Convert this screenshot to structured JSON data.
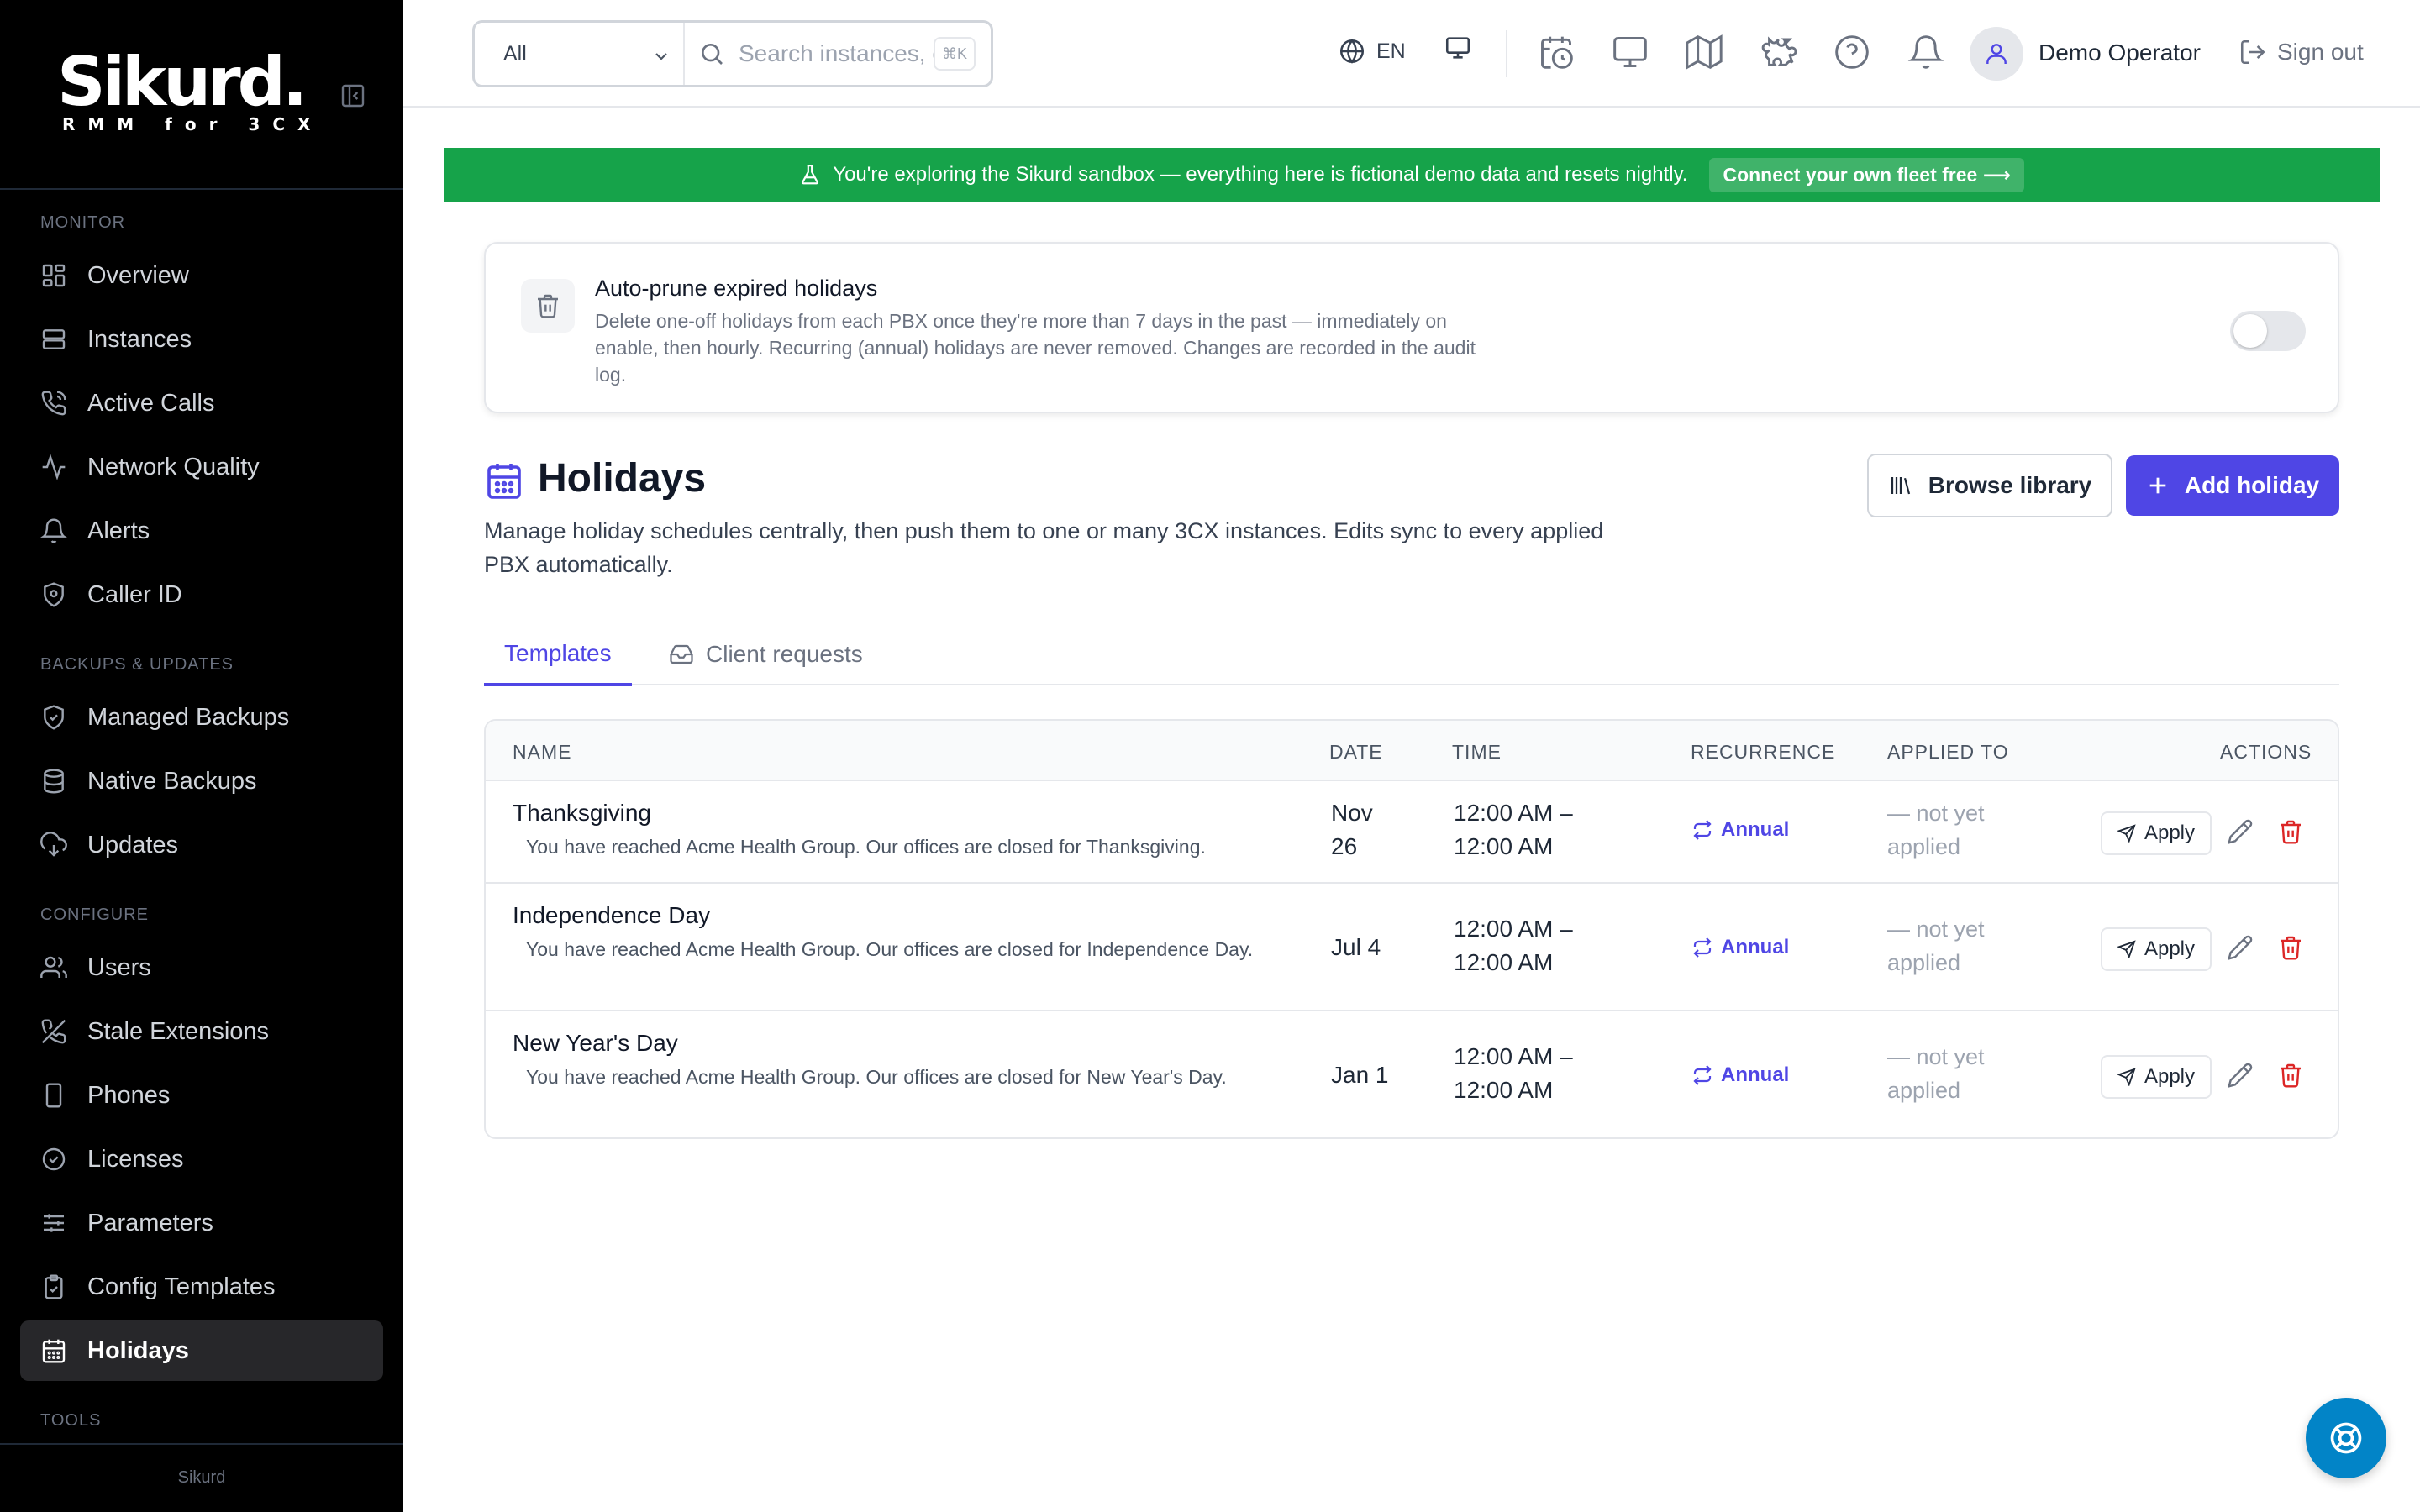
{
  "app": {
    "brand_name": "Sikurd.",
    "brand_tagline": "RMM for 3CX",
    "footer": "Sikurd"
  },
  "sidebar": {
    "sections": [
      {
        "title": "MONITOR",
        "items": [
          {
            "label": "Overview",
            "icon": "overview-icon"
          },
          {
            "label": "Instances",
            "icon": "server-icon"
          },
          {
            "label": "Active Calls",
            "icon": "phone-call-icon"
          },
          {
            "label": "Network Quality",
            "icon": "activity-icon"
          },
          {
            "label": "Alerts",
            "icon": "bell-icon"
          },
          {
            "label": "Caller ID",
            "icon": "shield-icon"
          }
        ]
      },
      {
        "title": "BACKUPS & UPDATES",
        "items": [
          {
            "label": "Managed Backups",
            "icon": "shield-check-icon"
          },
          {
            "label": "Native Backups",
            "icon": "database-icon"
          },
          {
            "label": "Updates",
            "icon": "cloud-download-icon"
          }
        ]
      },
      {
        "title": "CONFIGURE",
        "items": [
          {
            "label": "Users",
            "icon": "users-icon"
          },
          {
            "label": "Stale Extensions",
            "icon": "phone-off-icon"
          },
          {
            "label": "Phones",
            "icon": "smartphone-icon"
          },
          {
            "label": "Licenses",
            "icon": "badge-check-icon"
          },
          {
            "label": "Parameters",
            "icon": "sliders-icon"
          },
          {
            "label": "Config Templates",
            "icon": "clipboard-icon"
          },
          {
            "label": "Holidays",
            "icon": "calendar-icon",
            "active": true
          }
        ]
      },
      {
        "title": "TOOLS",
        "items": []
      }
    ]
  },
  "header": {
    "scope_value": "All",
    "search_placeholder": "Search instances, extensions, phones…",
    "shortcut": "⌘K",
    "language": "EN",
    "user_name": "Demo Operator",
    "sign_out": "Sign out"
  },
  "banner": {
    "text": "You're exploring the Sikurd sandbox — everything here is fictional demo data and resets nightly.",
    "cta": "Connect your own fleet free ⟶",
    "color": "#16a34a"
  },
  "auto_prune": {
    "title": "Auto-prune expired holidays",
    "description": "Delete one-off holidays from each PBX once they're more than 7 days in the past — immediately on enable, then hourly. Recurring (annual) holidays are never removed. Changes are recorded in the audit log.",
    "enabled": false
  },
  "page": {
    "title": "Holidays",
    "description": "Manage holiday schedules centrally, then push them to one or many 3CX instances. Edits sync to every applied PBX automatically.",
    "browse_library": "Browse library",
    "add_holiday": "Add holiday",
    "accent": "#4f46e5"
  },
  "tabs": [
    {
      "label": "Templates",
      "active": true
    },
    {
      "label": "Client requests",
      "active": false
    }
  ],
  "table": {
    "columns": {
      "name": "NAME",
      "date": "DATE",
      "time": "TIME",
      "recurrence": "RECURRENCE",
      "applied_to": "APPLIED TO",
      "actions": "ACTIONS"
    },
    "apply_label": "Apply",
    "rows": [
      {
        "name": "Thanksgiving",
        "message": "You have reached Acme Health Group. Our offices are closed for Thanksgiving.",
        "date_line1": "Nov",
        "date_line2": "26",
        "time_line1": "12:00 AM –",
        "time_line2": "12:00 AM",
        "recurrence": "Annual",
        "applied_line1": "— not yet",
        "applied_line2": "applied"
      },
      {
        "name": "Independence Day",
        "message": "You have reached Acme Health Group. Our offices are closed for Independence Day.",
        "date_line1": "Jul 4",
        "date_line2": "",
        "time_line1": "12:00 AM –",
        "time_line2": "12:00 AM",
        "recurrence": "Annual",
        "applied_line1": "— not yet",
        "applied_line2": "applied"
      },
      {
        "name": "New Year's Day",
        "message": "You have reached Acme Health Group. Our offices are closed for New Year's Day.",
        "date_line1": "Jan 1",
        "date_line2": "",
        "time_line1": "12:00 AM –",
        "time_line2": "12:00 AM",
        "recurrence": "Annual",
        "applied_line1": "— not yet",
        "applied_line2": "applied"
      }
    ]
  }
}
